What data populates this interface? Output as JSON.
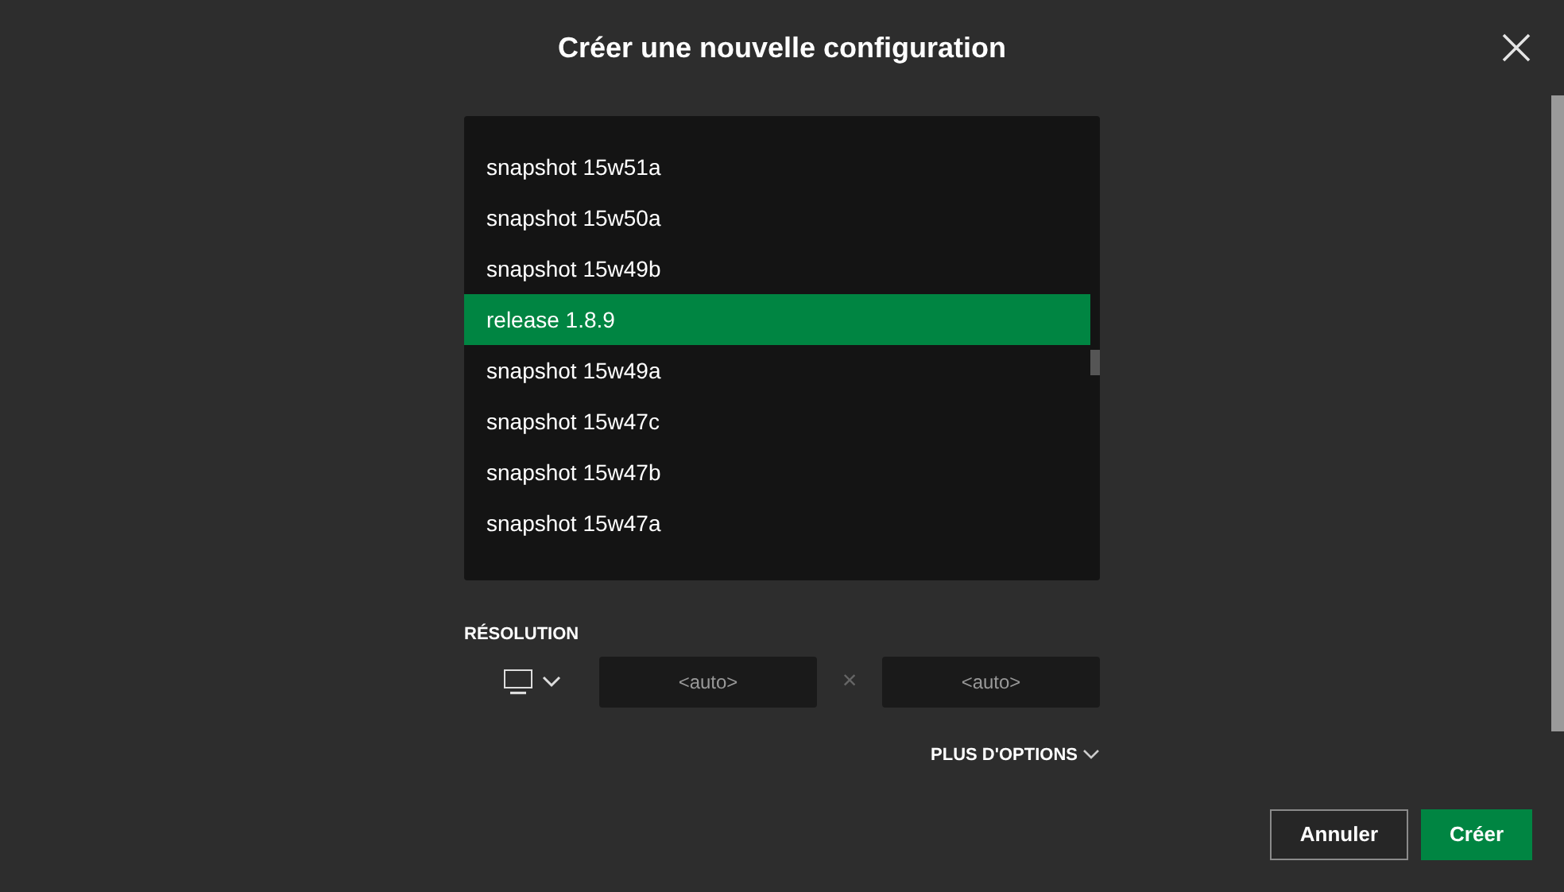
{
  "dialog": {
    "title": "Créer une nouvelle configuration"
  },
  "versions": [
    {
      "label": "snapshot 15w51a",
      "selected": false
    },
    {
      "label": "snapshot 15w50a",
      "selected": false
    },
    {
      "label": "snapshot 15w49b",
      "selected": false
    },
    {
      "label": "release 1.8.9",
      "selected": true
    },
    {
      "label": "snapshot 15w49a",
      "selected": false
    },
    {
      "label": "snapshot 15w47c",
      "selected": false
    },
    {
      "label": "snapshot 15w47b",
      "selected": false
    },
    {
      "label": "snapshot 15w47a",
      "selected": false
    }
  ],
  "resolution": {
    "label": "RÉSOLUTION",
    "width": {
      "placeholder": "<auto>"
    },
    "separator": "×",
    "height": {
      "placeholder": "<auto>"
    }
  },
  "more_options": {
    "label": "PLUS D'OPTIONS",
    "expanded": false
  },
  "buttons": [
    {
      "kind": "secondary",
      "label": "Annuler"
    },
    {
      "kind": "primary",
      "label": "Créer"
    }
  ]
}
